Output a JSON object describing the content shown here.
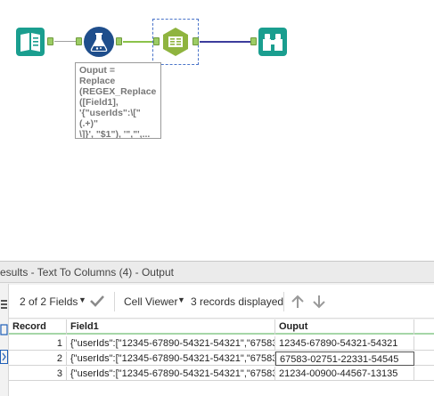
{
  "workflow": {
    "tools": [
      {
        "name": "Input Data",
        "icon": "book-icon"
      },
      {
        "name": "Formula",
        "icon": "flask-icon"
      },
      {
        "name": "Text To Columns",
        "icon": "text-to-columns-icon"
      },
      {
        "name": "Browse",
        "icon": "binoculars-icon"
      }
    ],
    "annotation": "Ouput =\nReplace\n(REGEX_Replace\n([Field1],\n'{\"userIds\":\\[\"(.+)\"\n\\]}', \"$1\"), '\",\"',...",
    "colors": {
      "input": "#1a9e8f",
      "formula": "#1f4e8c",
      "parse": "#8fb43f",
      "browse": "#1a9e8f",
      "connector": "#8bc34a",
      "connector_out": "#3c3c9c"
    }
  },
  "results": {
    "title": "esults - Text To Columns (4) - Output",
    "fields_label": "2 of 2 Fields",
    "viewer_label": "Cell Viewer",
    "records_label": "3 records displayed",
    "columns": [
      "Record",
      "Field1",
      "Ouput"
    ],
    "rows": [
      {
        "record": "1",
        "field1": "{\"userIds\":[\"12345-67890-54321-54321\",\"67583-...",
        "ouput": "12345-67890-54321-54321"
      },
      {
        "record": "2",
        "field1": "{\"userIds\":[\"12345-67890-54321-54321\",\"67583-...",
        "ouput": "67583-02751-22331-54545"
      },
      {
        "record": "3",
        "field1": "{\"userIds\":[\"12345-67890-54321-54321\",\"67583-...",
        "ouput": "21234-00900-44567-13135"
      }
    ]
  }
}
